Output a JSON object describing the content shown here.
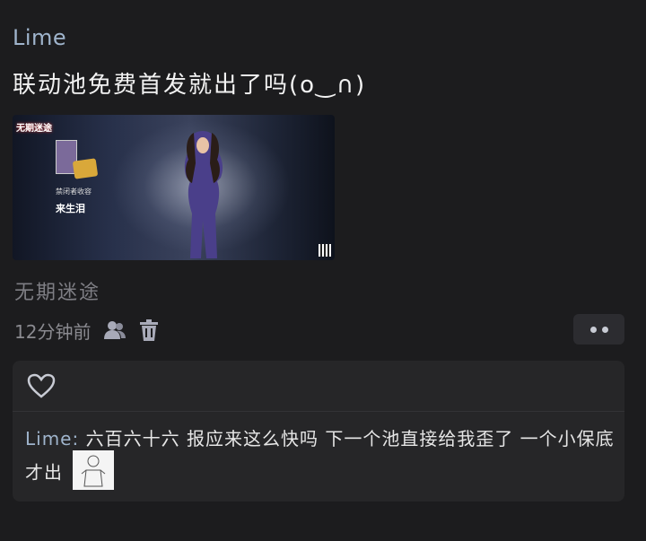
{
  "post": {
    "author": "Lime",
    "text": "联动池免费首发就出了吗(o‿∩)",
    "image": {
      "game_logo": "无期迷途",
      "character_name": "来生泪",
      "faction_label": "禁闭者收容"
    },
    "game_name": "无期迷途",
    "time": "12分钟前"
  },
  "icons": {
    "author_icon": "users-icon",
    "delete_icon": "trash-icon",
    "more_icon": "more-dots-icon",
    "like_icon": "heart-icon"
  },
  "comments": [
    {
      "author": "Lime",
      "separator": ":",
      "text": "六百六十六  报应来这么快吗  下一个池直接给我歪了  一个小保底才出"
    }
  ],
  "colors": {
    "background": "#1c1c1e",
    "panel": "#262628",
    "accent": "#9fb4cc"
  }
}
